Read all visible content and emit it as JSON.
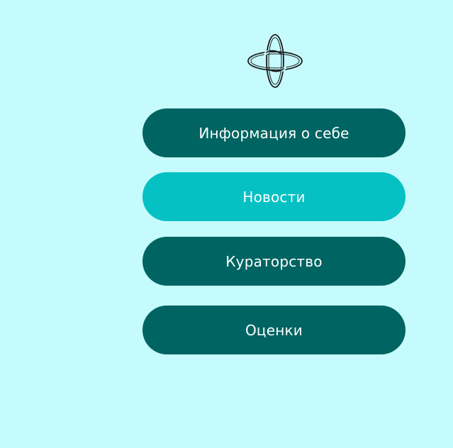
{
  "logo": {
    "icon": "interlocked-rings-logo"
  },
  "menu": {
    "items": [
      {
        "label": "Информация о себе",
        "color": "#006462",
        "active": false
      },
      {
        "label": "Новости",
        "color": "#05c1c3",
        "active": true
      },
      {
        "label": "Кураторство",
        "color": "#006462",
        "active": false
      },
      {
        "label": "Оценки",
        "color": "#006462",
        "active": false
      }
    ]
  },
  "colors": {
    "background": "#c6fbfd",
    "button_default": "#006462",
    "button_active": "#05c1c3",
    "text": "#ffffff"
  }
}
